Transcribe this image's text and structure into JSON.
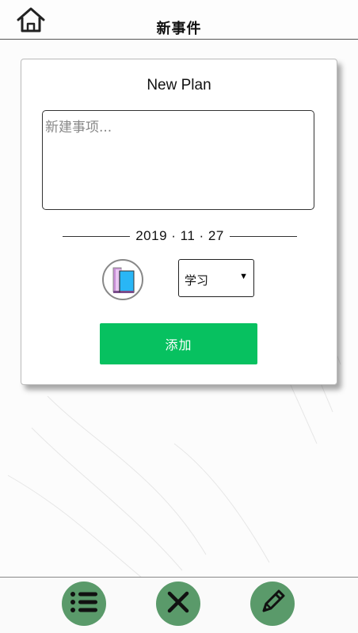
{
  "header": {
    "title": "新事件",
    "home_icon": "home-icon"
  },
  "card": {
    "title": "New Plan",
    "input": {
      "value": "",
      "placeholder": "新建事项..."
    },
    "date": "2019 · 11 · 27",
    "category": {
      "icon": "book-icon",
      "selected": "学习"
    },
    "add_label": "添加"
  },
  "footer": {
    "tabs": [
      {
        "icon": "list-icon"
      },
      {
        "icon": "close-icon"
      },
      {
        "icon": "pencil-icon"
      }
    ]
  },
  "colors": {
    "accent": "#07c160",
    "tab_bg": "#5a9a6a"
  }
}
